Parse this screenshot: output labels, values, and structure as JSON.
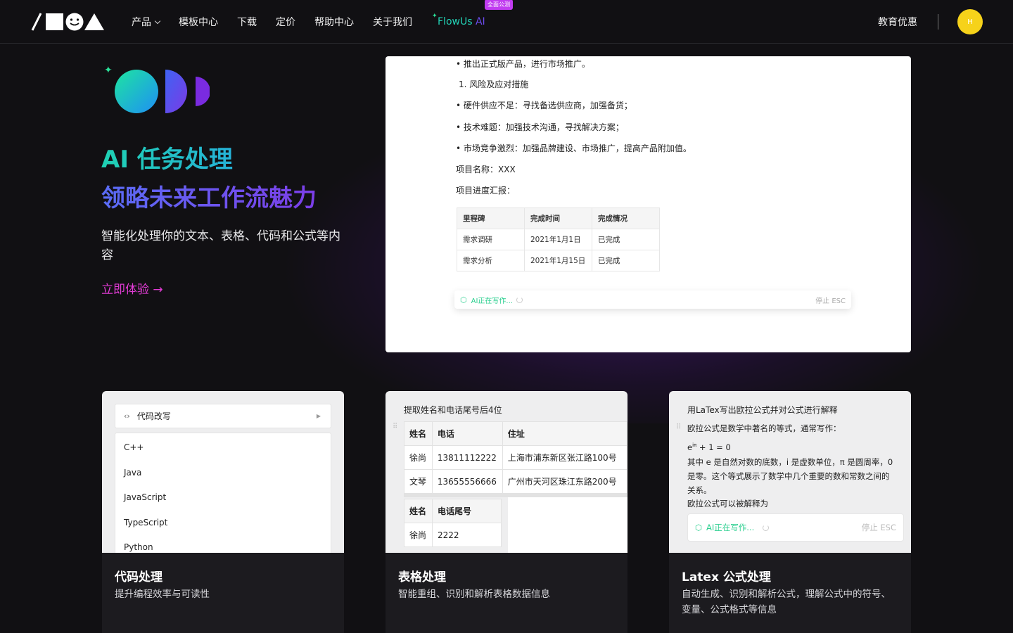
{
  "nav": {
    "items": [
      {
        "label": "产品",
        "has_dropdown": true
      },
      {
        "label": "模板中心"
      },
      {
        "label": "下载"
      },
      {
        "label": "定价"
      },
      {
        "label": "帮助中心"
      },
      {
        "label": "关于我们"
      }
    ],
    "ai_link": {
      "part1": "FlowUs",
      "part2": " AI",
      "badge": "全面公测"
    },
    "edu": "教育优惠",
    "avatar_initial": "H"
  },
  "hero": {
    "title_line1": "AI 任务处理",
    "title_line2": "领略未来工作流魅力",
    "description": "智能化处理你的文本、表格、代码和公式等内容",
    "cta": "立即体验 →"
  },
  "doc": {
    "lines": [
      "• 推出正式版产品，进行市场推广。",
      "1. 风险及应对措施",
      "• 硬件供应不足：寻找备选供应商，加强备货；",
      "• 技术难题：加强技术沟通，寻找解决方案；",
      "• 市场竞争激烈：加强品牌建设、市场推广，提高产品附加值。",
      "项目名称：XXX",
      "项目进度汇报："
    ],
    "table": {
      "headers": [
        "里程碑",
        "完成时间",
        "完成情况"
      ],
      "rows": [
        [
          "需求调研",
          "2021年1月1日",
          "已完成"
        ],
        [
          "需求分析",
          "2021年1月15日",
          "已完成"
        ]
      ]
    },
    "ai_status": "AI正在写作...",
    "stop": "停止 ESC"
  },
  "cards": [
    {
      "title": "代码处理",
      "desc": "提升编程效率与可读性",
      "menu_head": "代码改写",
      "languages": [
        "C++",
        "Java",
        "JavaScript",
        "TypeScript",
        "Python"
      ]
    },
    {
      "title": "表格处理",
      "desc": "智能重组、识别和解析表格数据信息",
      "prompt": "提取姓名和电话尾号后4位",
      "table1": {
        "headers": [
          "姓名",
          "电话",
          "住址"
        ],
        "rows": [
          [
            "徐尚",
            "13811112222",
            "上海市浦东新区张江路100号"
          ],
          [
            "文琴",
            "13655556666",
            "广州市天河区珠江东路200号"
          ]
        ]
      },
      "table2": {
        "headers": [
          "姓名",
          "电话尾号"
        ],
        "rows": [
          [
            "徐尚",
            "2222"
          ]
        ]
      }
    },
    {
      "title": "Latex 公式处理",
      "desc": "自动生成、识别和解析公式，理解公式中的符号、变量、公式格式等信息",
      "prompt": "用LaTex写出欧拉公式并对公式进行解释",
      "p1": "欧拉公式是数学中著名的等式，通常写作：",
      "formula_base": "e",
      "formula_sup": "iπ",
      "formula_rest": " + 1 = 0",
      "p2": "其中 e 是自然对数的底数，i 是虚数单位，π 是圆周率，0 是零。这个等式展示了数学中几个重要的数和常数之间的关系。",
      "p3": "欧拉公式可以被解释为",
      "ai_status": "AI正在写作...",
      "stop": "停止 ESC"
    }
  ],
  "colors": {
    "background": "#111013",
    "teal": "#20c5c7",
    "purple": "#7c3ee8",
    "cta_pink": "#e23cd5",
    "ai_green": "#2bcf8f",
    "avatar_yellow": "#f6d21a"
  }
}
